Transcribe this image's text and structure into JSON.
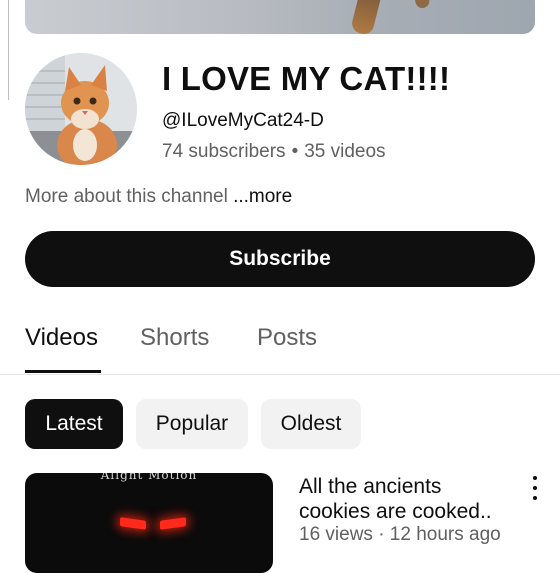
{
  "channel": {
    "title": "I LOVE MY CAT!!!!",
    "handle": "@ILoveMyCat24-D",
    "subscribers": "74 subscribers",
    "separator": "•",
    "videos": "35 videos",
    "about_text": "More about this channel",
    "about_more": "...more"
  },
  "subscribe_label": "Subscribe",
  "tabs": [
    {
      "label": "Videos",
      "active": true
    },
    {
      "label": "Shorts",
      "active": false
    },
    {
      "label": "Posts",
      "active": false
    }
  ],
  "chips": [
    {
      "label": "Latest",
      "active": true
    },
    {
      "label": "Popular",
      "active": false
    },
    {
      "label": "Oldest",
      "active": false
    }
  ],
  "video": {
    "thumbnail_watermark": "Alight Motion",
    "title_line1": "All the ancients",
    "title_line2": "cookies are cooked..",
    "meta": "16 views · 12 hours ago",
    "menu_icon": "more-vert-icon"
  },
  "colors": {
    "button_bg": "#0f0f0f",
    "secondary_text": "#606060",
    "chip_bg": "#f2f2f2",
    "eye_glow": "#ff2a1a"
  }
}
